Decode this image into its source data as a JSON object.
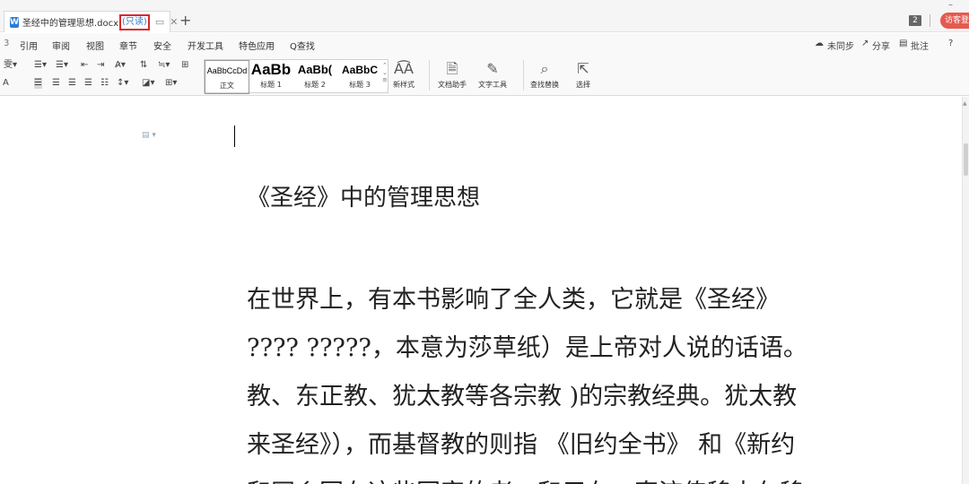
{
  "tabbar": {
    "doc_icon": "W",
    "filename": "圣经中的管理思想.docx",
    "readonly": "(只读)",
    "new_tab": "+",
    "tab_count": "2",
    "guest_button": "访客登",
    "minimize": "–"
  },
  "menu": {
    "items": [
      "引用",
      "审阅",
      "视图",
      "章节",
      "安全",
      "开发工具",
      "特色应用",
      "Q查找"
    ],
    "right": {
      "sync": "未同步",
      "share": "分享",
      "comment": "批注",
      "help": "?"
    }
  },
  "ribbon": {
    "styles": [
      {
        "preview": "AaBbCcDd",
        "name": "正文"
      },
      {
        "preview": "AaBb",
        "name": "标题 1"
      },
      {
        "preview": "AaBb(",
        "name": "标题 2"
      },
      {
        "preview": "AaBbC",
        "name": "标题 3"
      }
    ],
    "new_style": "新样式",
    "doc_helper": "文档助手",
    "text_tools": "文字工具",
    "find_replace": "查找替换",
    "select": "选择"
  },
  "document": {
    "title": "《圣经》中的管理思想",
    "lines": [
      "在世界上，有本书影响了全人类，它就是《圣经》",
      "???? ?????，本意为莎草纸）是上帝对人说的话语。",
      "教、东正教、犹太教等各宗教    )的宗教经典。犹太教",
      "来圣经》），而基督教的则指 《旧约全书》 和《新约",
      "和同乡团在这些国家的老一和用在一直流传移太久移"
    ]
  },
  "colors": {
    "accent_blue": "#2b7bd8",
    "readonly_border": "#e0262d",
    "guest_button": "#e65a4f"
  },
  "icons": [
    "word-doc-icon",
    "screen-icon",
    "close-icon",
    "cloud-icon",
    "share-icon",
    "comment-icon",
    "doc-helper-icon",
    "wrench-icon",
    "find-replace-icon",
    "select-cursor-icon",
    "paragraph-mark-icon"
  ]
}
